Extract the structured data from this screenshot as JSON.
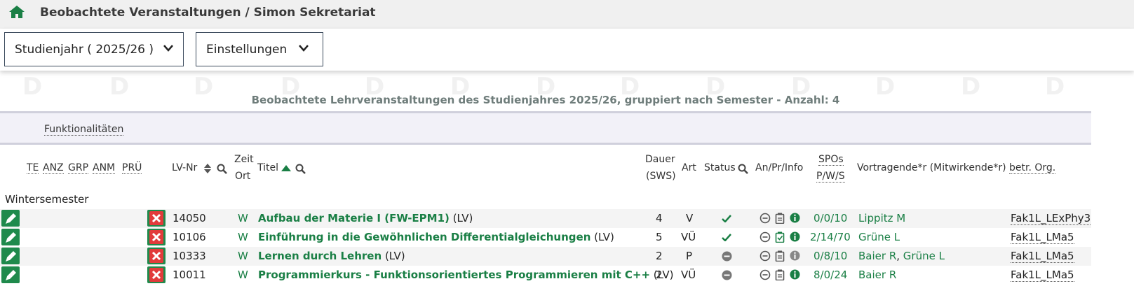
{
  "header": {
    "home_icon": "home-icon",
    "breadcrumb": "Beobachtete Veranstaltungen / Simon Sekretariat"
  },
  "toolbar": {
    "year_select": "Studienjahr ( 2025/26 )",
    "settings_select": "Einstellungen"
  },
  "watermark_letter": "D",
  "heading": "Beobachtete Lehrveranstaltungen des Studienjahres 2025/26, gruppiert nach Semester - Anzahl: 4",
  "functions_link": "Funktionalitäten",
  "columns": {
    "te": "TE",
    "anz": "ANZ",
    "grp": "GRP",
    "anm": "ANM",
    "pru": "PRÜ",
    "lvnr": "LV-Nr",
    "zeit": "Zeit",
    "ort": "Ort",
    "titel": "Titel",
    "dauer": "Dauer",
    "sws": "(SWS)",
    "art": "Art",
    "status": "Status",
    "anprinfo": "An/Pr/Info",
    "spos": "SPOs",
    "pws": "P/W/S",
    "vortragende": "Vortragende*r (Mitwirkende*r)",
    "org": "betr. Org."
  },
  "group_label": "Wintersemester",
  "colors": {
    "accent_green": "#1a7f45",
    "button_green": "#1f8a4c",
    "delete_red": "#e23b3b"
  },
  "rows": [
    {
      "lvnr": "14050",
      "zeit": "W",
      "titel": "Aufbau der Materie I (FW-EPM1)",
      "typ": "(LV)",
      "dauer": "4",
      "art": "V",
      "status": "check-icon",
      "spos": "0/0/10",
      "vortragende": [
        "Lippitz M"
      ],
      "org": "Fak1L_LExPhy3"
    },
    {
      "lvnr": "10106",
      "zeit": "W",
      "titel": "Einführung in die Gewöhnlichen Differentialgleichungen",
      "typ": "(LV)",
      "dauer": "5",
      "art": "VÜ",
      "status": "check-icon",
      "spos": "2/14/70",
      "vortragende": [
        "Grüne L"
      ],
      "org": "Fak1L_LMa5"
    },
    {
      "lvnr": "10333",
      "zeit": "W",
      "titel": "Lernen durch Lehren",
      "typ": "(LV)",
      "dauer": "2",
      "art": "P",
      "status": "minus-circle-icon",
      "spos": "0/8/10",
      "vortragende": [
        "Baier R",
        "Grüne L"
      ],
      "org": "Fak1L_LMa5"
    },
    {
      "lvnr": "10011",
      "zeit": "W",
      "titel": "Programmierkurs - Funktionsorientiertes Programmieren mit C++",
      "typ": "(LV)",
      "dauer": "2",
      "art": "VÜ",
      "status": "minus-circle-icon",
      "spos": "8/0/24",
      "vortragende": [
        "Baier R"
      ],
      "org": "Fak1L_LMa5"
    }
  ],
  "vortragende_separator": ", "
}
